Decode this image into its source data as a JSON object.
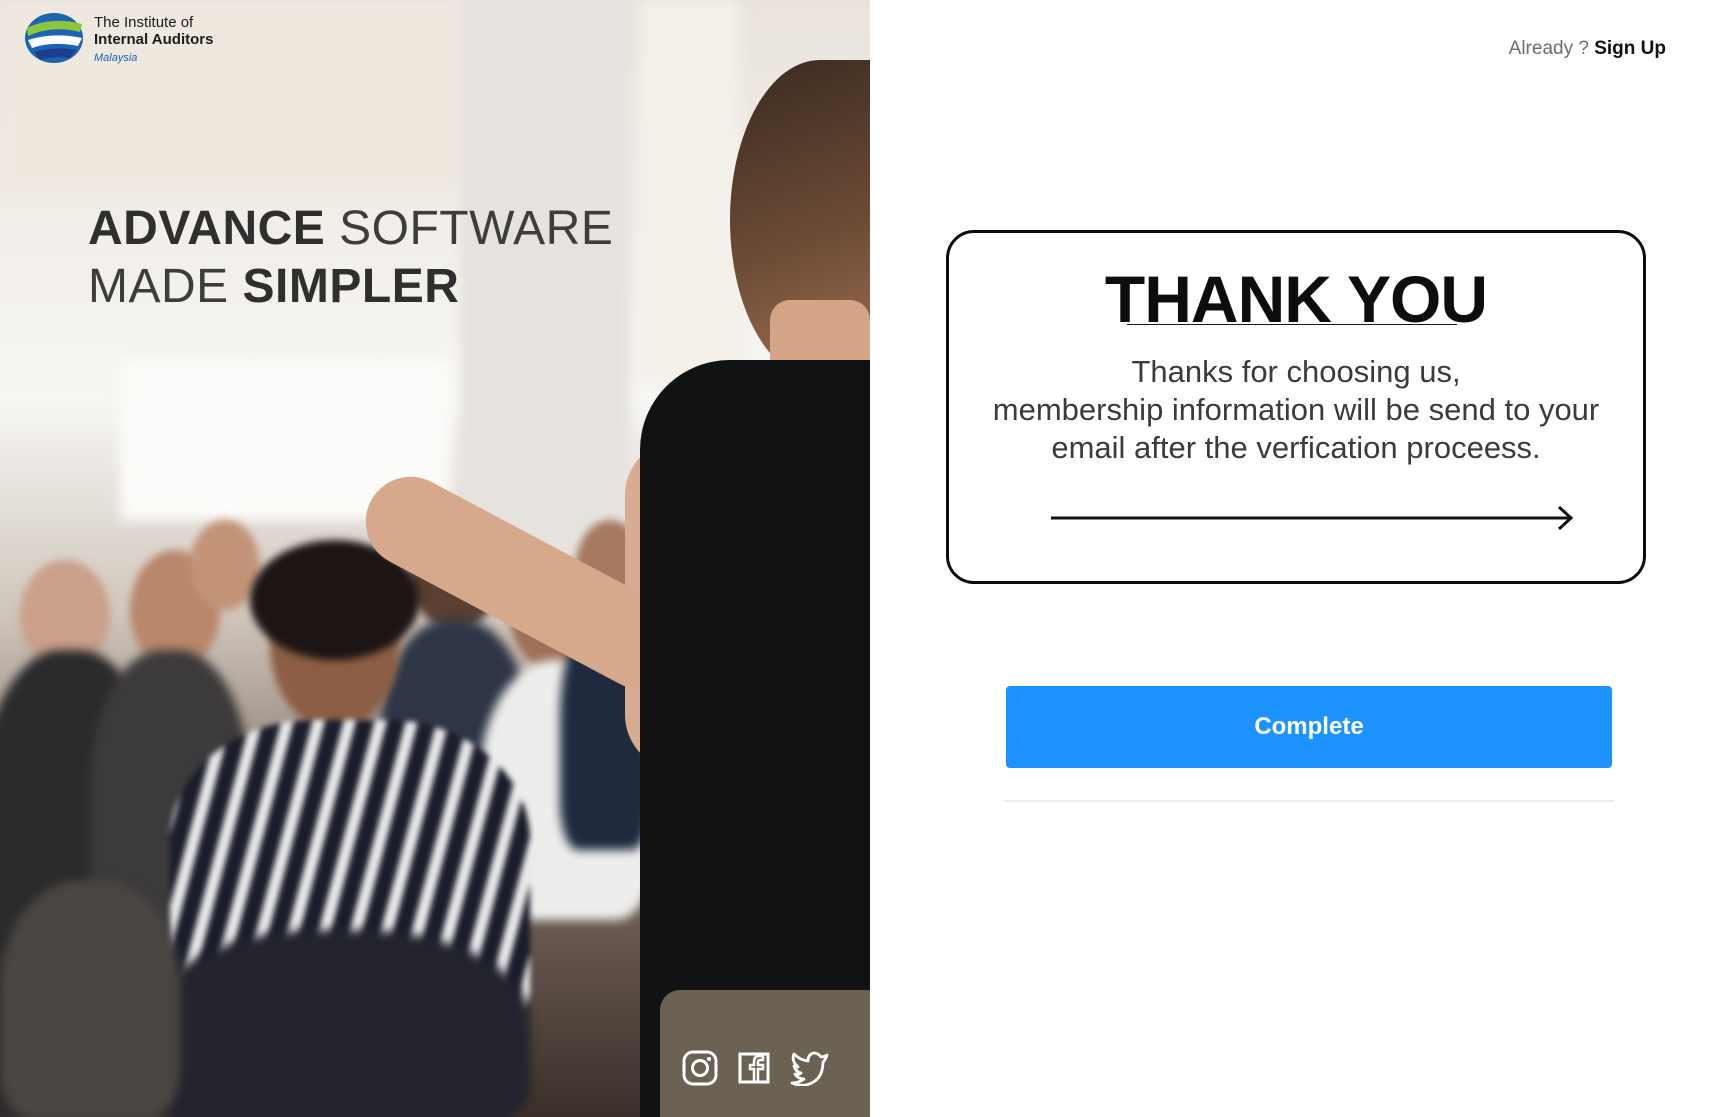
{
  "brand": {
    "line1": "The Institute of",
    "line2": "Internal Auditors",
    "line3": "Malaysia",
    "colors": {
      "blue": "#1a64b4",
      "green": "#8cc63f",
      "navy": "#1d3f8a"
    }
  },
  "hero": {
    "title_word1": "ADVANCE",
    "title_word2": " SOFTWARE",
    "title_word3": "MADE ",
    "title_word4": "SIMPLER"
  },
  "social": {
    "icons": [
      "instagram-icon",
      "facebook-icon",
      "twitter-icon"
    ]
  },
  "header": {
    "already_text": "Already ?",
    "signup_label": "Sign Up"
  },
  "card": {
    "title": "THANK YOU",
    "message_line1": "Thanks for choosing us,",
    "message_line2": "membership information will be send to your",
    "message_line3": "email after the verfication proceess."
  },
  "actions": {
    "complete_label": "Complete",
    "accent": "#1c93ff"
  }
}
